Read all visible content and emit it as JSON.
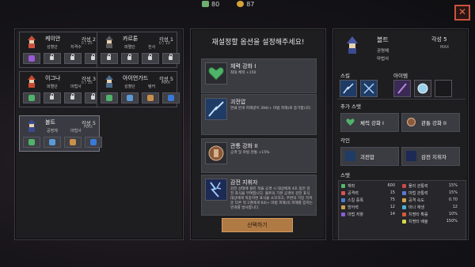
{
  "topbar": {
    "hp": "80",
    "gold": "87"
  },
  "close_label": "✕",
  "heroes": [
    {
      "name": "케이안",
      "grade": "각성 2",
      "count": "0 / 25",
      "role1": "성혈단",
      "role2": "저격수",
      "slot_types": [
        "purple",
        "lock",
        "lock",
        "lock"
      ]
    },
    {
      "name": "카르툰",
      "grade": "각성 1",
      "count": "0 / 10",
      "role1": "파멸단",
      "role2": "전사",
      "slot_types": [
        "lock",
        "lock",
        "lock",
        "lock"
      ]
    },
    {
      "name": "이그나",
      "grade": "각성 3",
      "count": "0 / 35",
      "role1": "파멸단",
      "role2": "마법사",
      "slot_types": [
        "green",
        "lock",
        "lock",
        "lock"
      ]
    },
    {
      "name": "아이언가드",
      "grade": "각성 5",
      "count": "MAX",
      "role1": "성혈단",
      "role2": "탱커",
      "slot_types": [
        "green",
        "sword",
        "fist",
        "blue"
      ]
    },
    {
      "name": "볼트",
      "grade": "각성 5",
      "count": "MAX",
      "role1": "공명체",
      "role2": "마법사",
      "slot_types": [
        "green",
        "sword",
        "fist",
        "blue"
      ]
    }
  ],
  "middle": {
    "title": "재설정할 옵션을 설정해주세요!",
    "options": [
      {
        "title": "체력 강화 I",
        "desc": "최대 체력 +150"
      },
      {
        "title": "괴전압",
        "desc": "연쇄 번개 피해량이 394(+ 마법 피해)로 증가합니다."
      },
      {
        "title": "관통 강화 II",
        "desc": "공격 및 마법 관통 +15%"
      },
      {
        "title": "감전 지휘자",
        "desc": "감전 상태에 걸린 적을 공격 시 대상에게 4초 동안 감전 표식을 부여합니다. 볼트의 기본 공격이 감전 표식 대상에게 적중하면 표식을 소모하고, 주변의 가장 가까운 다른 적 1명에게 64(+ 마법 피해)의 피해를 입히는 번개를 발사합니다."
      }
    ],
    "select_label": "선택하기"
  },
  "detail": {
    "name": "볼트",
    "grade": "각성 5",
    "max": "MAX",
    "role1": "공명체",
    "role2": "마법사",
    "skill_label": "스킬",
    "item_label": "아이템",
    "extra_stat_label": "추가 스탯",
    "extra_stats": [
      "체력 강화 I",
      "관통 강화 II"
    ],
    "awaken_label": "각인",
    "awakens": [
      "괴전압",
      "감전 지휘자"
    ],
    "stat_label": "스탯",
    "stats_left": [
      {
        "name": "체력",
        "value": "600",
        "color": "#58b86a"
      },
      {
        "name": "공격력",
        "value": "15",
        "color": "#d9534f"
      },
      {
        "name": "스킬 증폭",
        "value": "75",
        "color": "#4a7dd6"
      },
      {
        "name": "방어력",
        "value": "12",
        "color": "#c9a24a"
      },
      {
        "name": "마법 저항",
        "value": "14",
        "color": "#8a5ed6"
      }
    ],
    "stats_right": [
      {
        "name": "물리 관통력",
        "value": "15%",
        "color": "#c94a4a"
      },
      {
        "name": "마법 관통력",
        "value": "15%",
        "color": "#5a7ad6"
      },
      {
        "name": "공격 속도",
        "value": "0.70",
        "color": "#d6a24a"
      },
      {
        "name": "마나 재생",
        "value": "12",
        "color": "#4ab0d6"
      },
      {
        "name": "치명타 확률",
        "value": "10%",
        "color": "#d65a3a"
      },
      {
        "name": "치명타 배율",
        "value": "150%",
        "color": "#d6d64a"
      }
    ]
  }
}
